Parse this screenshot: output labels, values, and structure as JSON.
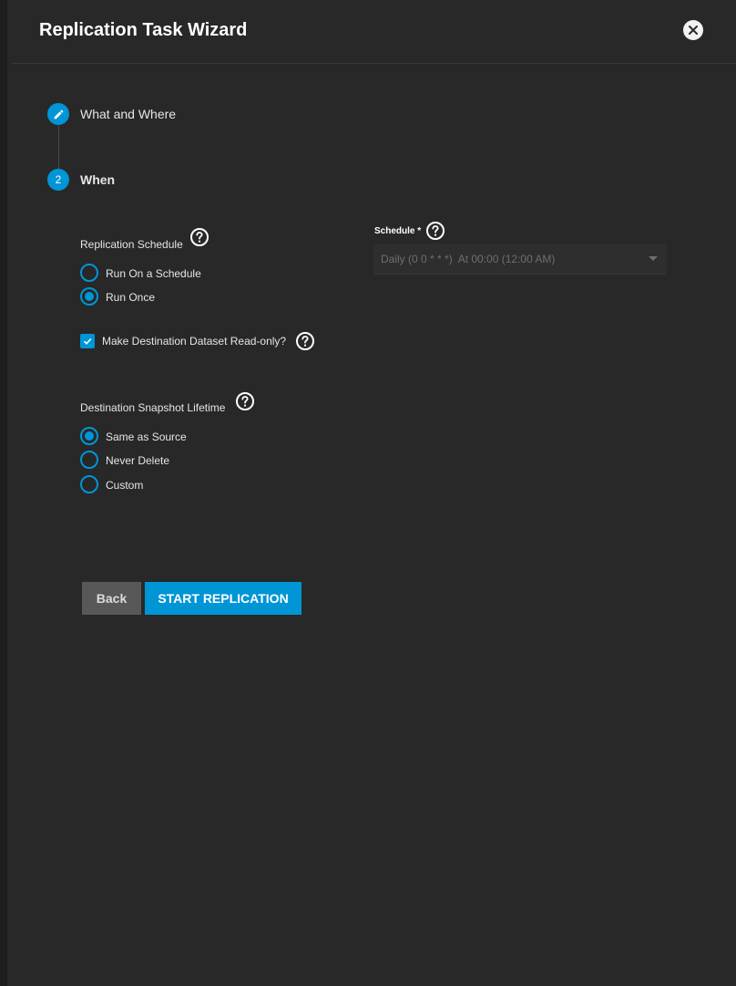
{
  "dialog": {
    "title": "Replication Task Wizard"
  },
  "steps": [
    {
      "label": "What and Where",
      "icon": "pencil-icon"
    },
    {
      "label": "When",
      "number": "2"
    }
  ],
  "replication_schedule": {
    "label": "Replication Schedule",
    "options": [
      {
        "label": "Run On a Schedule",
        "selected": false
      },
      {
        "label": "Run Once",
        "selected": true
      }
    ]
  },
  "schedule": {
    "label": "Schedule",
    "required_mark": "*",
    "value": "Daily (0 0 * * *)  At 00:00 (12:00 AM)"
  },
  "readonly": {
    "label": "Make Destination Dataset Read-only?",
    "checked": true
  },
  "lifetime": {
    "label": "Destination Snapshot Lifetime",
    "options": [
      {
        "label": "Same as Source",
        "selected": true
      },
      {
        "label": "Never Delete",
        "selected": false
      },
      {
        "label": "Custom",
        "selected": false
      }
    ]
  },
  "buttons": {
    "back": "Back",
    "start": "START REPLICATION"
  },
  "colors": {
    "accent": "#0095d5",
    "background": "#282828"
  }
}
